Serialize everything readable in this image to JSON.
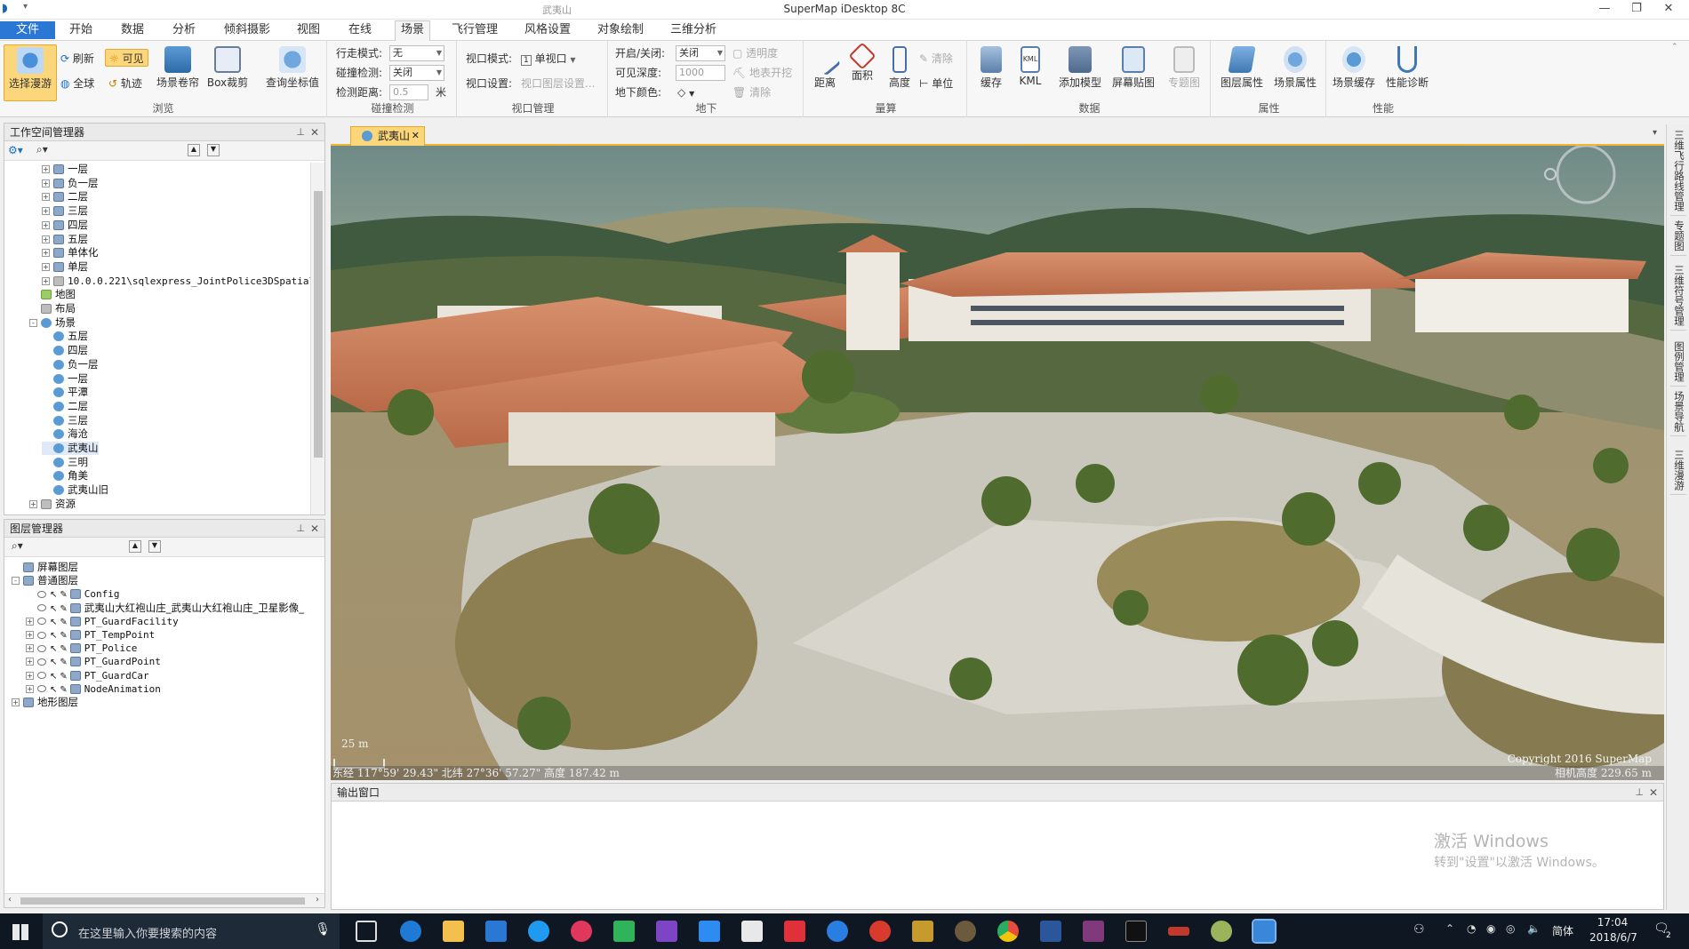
{
  "app": {
    "title": "SuperMap iDesktop 8C",
    "document_title": "武夷山"
  },
  "menu": {
    "items": [
      "文件",
      "开始",
      "数据",
      "分析",
      "倾斜摄影",
      "视图",
      "在线",
      "场景",
      "飞行管理",
      "风格设置",
      "对象绘制",
      "三维分析"
    ],
    "active": "场景"
  },
  "ribbon": {
    "browse": {
      "label": "浏览",
      "select_roam": "选择漫游",
      "refresh": "刷新",
      "visible": "可见",
      "full_extent": "全球",
      "track": "轨迹",
      "scene_curtain": "场景卷帘",
      "box_clip": "Box裁剪",
      "query_coords": "查询坐标值"
    },
    "collision": {
      "label": "碰撞检测",
      "walk_mode_label": "行走模式:",
      "walk_mode_value": "无",
      "collision_check_label": "碰撞检测:",
      "collision_check_value": "关闭",
      "check_distance_label": "检测距离:",
      "check_distance_value": "0.5",
      "unit": "米"
    },
    "viewport": {
      "label": "视口管理",
      "mode_label": "视口模式:",
      "mode_value": "单视口",
      "settings_label": "视口设置:",
      "settings_value": "视口图层设置..."
    },
    "underground": {
      "label": "地下",
      "toggle_label": "开启/关闭:",
      "toggle_value": "关闭",
      "depth_label": "可见深度:",
      "depth_value": "1000",
      "color_label": "地下颜色:",
      "transparency": "透明度",
      "surface_dig": "地表开挖",
      "clear": "清除"
    },
    "measure": {
      "label": "量算",
      "distance": "距离",
      "area": "面积",
      "height": "高度",
      "clear": "清除",
      "unit": "单位"
    },
    "data": {
      "label": "数据",
      "cache": "缓存",
      "kml": "KML",
      "add_model": "添加模型",
      "screen_layer": "屏幕贴图",
      "thematic": "专题图"
    },
    "properties": {
      "label": "属性",
      "layer_props": "图层属性",
      "scene_props": "场景属性"
    },
    "performance": {
      "label": "性能",
      "scene_cache": "场景缓存",
      "diagnose": "性能诊断"
    }
  },
  "workspace": {
    "title": "工作空间管理器",
    "items": [
      {
        "label": "一层",
        "indent": 3,
        "type": "lay",
        "ex": "+"
      },
      {
        "label": "负一层",
        "indent": 3,
        "type": "lay",
        "ex": "+"
      },
      {
        "label": "二层",
        "indent": 3,
        "type": "lay",
        "ex": "+"
      },
      {
        "label": "三层",
        "indent": 3,
        "type": "lay",
        "ex": "+"
      },
      {
        "label": "四层",
        "indent": 3,
        "type": "lay",
        "ex": "+"
      },
      {
        "label": "五层",
        "indent": 3,
        "type": "lay",
        "ex": "+"
      },
      {
        "label": "单体化",
        "indent": 3,
        "type": "lay",
        "ex": "+"
      },
      {
        "label": "单层",
        "indent": 3,
        "type": "lay",
        "ex": "+"
      },
      {
        "label": "10.0.0.221\\sqlexpress_JointPolice3DSpatial",
        "indent": 3,
        "type": "db",
        "ex": "+"
      },
      {
        "label": "地图",
        "indent": 2,
        "type": "map",
        "ex": ""
      },
      {
        "label": "布局",
        "indent": 2,
        "type": "db",
        "ex": ""
      },
      {
        "label": "场景",
        "indent": 2,
        "type": "scn",
        "ex": "-"
      },
      {
        "label": "五层",
        "indent": 3,
        "type": "scn",
        "ex": ""
      },
      {
        "label": "四层",
        "indent": 3,
        "type": "scn",
        "ex": ""
      },
      {
        "label": "负一层",
        "indent": 3,
        "type": "scn",
        "ex": ""
      },
      {
        "label": "一层",
        "indent": 3,
        "type": "scn",
        "ex": ""
      },
      {
        "label": "平潭",
        "indent": 3,
        "type": "scn",
        "ex": ""
      },
      {
        "label": "二层",
        "indent": 3,
        "type": "scn",
        "ex": ""
      },
      {
        "label": "三层",
        "indent": 3,
        "type": "scn",
        "ex": ""
      },
      {
        "label": "海沧",
        "indent": 3,
        "type": "scn",
        "ex": ""
      },
      {
        "label": "武夷山",
        "indent": 3,
        "type": "scn",
        "ex": ""
      },
      {
        "label": "三明",
        "indent": 3,
        "type": "scn",
        "ex": ""
      },
      {
        "label": "角美",
        "indent": 3,
        "type": "scn",
        "ex": ""
      },
      {
        "label": "武夷山旧",
        "indent": 3,
        "type": "scn",
        "ex": ""
      },
      {
        "label": "资源",
        "indent": 2,
        "type": "db",
        "ex": "+"
      }
    ]
  },
  "layers": {
    "title": "图层管理器",
    "items": [
      {
        "label": "屏幕图层",
        "indent": 1,
        "ex": ""
      },
      {
        "label": "普通图层",
        "indent": 1,
        "ex": "-"
      },
      {
        "label": "Config",
        "indent": 3,
        "ex": ""
      },
      {
        "label": "武夷山大红袍山庄_武夷山大红袍山庄_卫星影像_",
        "indent": 3,
        "ex": ""
      },
      {
        "label": "PT_GuardFacility",
        "indent": 3,
        "ex": "+"
      },
      {
        "label": "PT_TempPoint",
        "indent": 3,
        "ex": "+"
      },
      {
        "label": "PT_Police",
        "indent": 3,
        "ex": "+"
      },
      {
        "label": "PT_GuardPoint",
        "indent": 3,
        "ex": "+"
      },
      {
        "label": "PT_GuardCar",
        "indent": 3,
        "ex": "+"
      },
      {
        "label": "NodeAnimation",
        "indent": 3,
        "ex": "+"
      },
      {
        "label": "地形图层",
        "indent": 1,
        "ex": "+"
      }
    ]
  },
  "scene": {
    "tab": "武夷山",
    "scale": "25 m",
    "coords": "东经 117°59' 29.43\"   北纬 27°36' 57.27\"   高度 187.42 m",
    "copyright": "Copyright 2016 SuperMap",
    "camera_height": "相机高度 229.65 m"
  },
  "output": {
    "title": "输出窗口",
    "activation_line1": "激活 Windows",
    "activation_line2": "转到\"设置\"以激活 Windows。"
  },
  "side_tabs": [
    "三维飞行路线管理",
    "专题图",
    "三维符号管理",
    "图例管理",
    "场景导航",
    "三维漫游"
  ],
  "taskbar": {
    "search_placeholder": "在这里输入你要搜索的内容",
    "time": "17:04",
    "date": "2018/6/7",
    "ime": "简体",
    "notification_count": "2"
  },
  "colors": {
    "accent": "#2b78d4",
    "selected": "#fbd67a",
    "taskbar": "#0f1722"
  }
}
